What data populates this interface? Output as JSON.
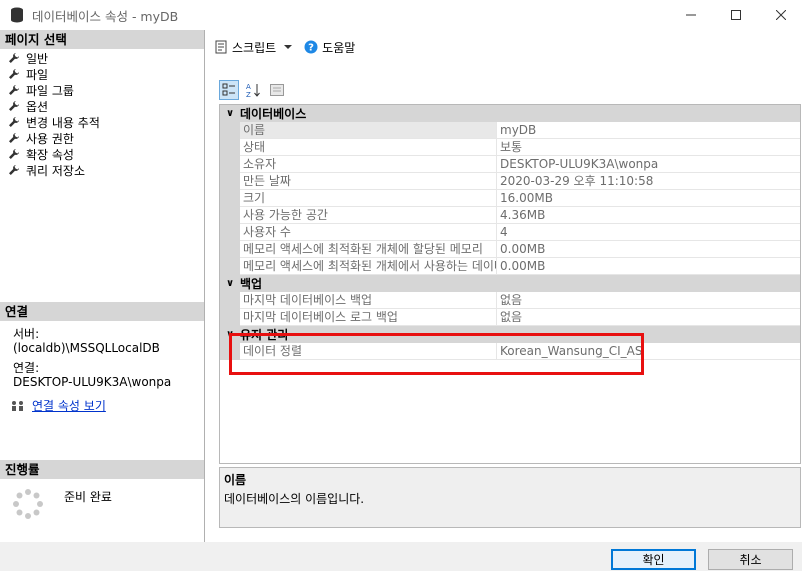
{
  "window": {
    "title": "데이터베이스 속성 - myDB"
  },
  "left": {
    "select_page_header": "페이지 선택",
    "pages": [
      {
        "label": "일반"
      },
      {
        "label": "파일"
      },
      {
        "label": "파일 그룹"
      },
      {
        "label": "옵션"
      },
      {
        "label": "변경 내용 추적"
      },
      {
        "label": "사용 권한"
      },
      {
        "label": "확장 속성"
      },
      {
        "label": "쿼리 저장소"
      }
    ],
    "connection_header": "연결",
    "server_label": "서버:",
    "server_value": "(localdb)\\MSSQLLocalDB",
    "conn_label": "연결:",
    "conn_value": "DESKTOP-ULU9K3A\\wonpa",
    "view_conn_link": "연결 속성 보기",
    "progress_header": "진행률",
    "progress_status": "준비 완료"
  },
  "toolbar": {
    "script_label": "스크립트",
    "help_label": "도움말"
  },
  "grid": {
    "categories": [
      {
        "name": "데이터베이스",
        "rows": [
          {
            "name": "이름",
            "value": "myDB"
          },
          {
            "name": "상태",
            "value": "보통"
          },
          {
            "name": "소유자",
            "value": "DESKTOP-ULU9K3A\\wonpa"
          },
          {
            "name": "만든 날짜",
            "value": "2020-03-29 오후 11:10:58"
          },
          {
            "name": "크기",
            "value": "16.00MB"
          },
          {
            "name": "사용 가능한 공간",
            "value": "4.36MB"
          },
          {
            "name": "사용자 수",
            "value": "4"
          },
          {
            "name": "메모리 액세스에 최적화된 개체에 할당된 메모리",
            "value": "0.00MB"
          },
          {
            "name": "메모리 액세스에 최적화된 개체에서 사용하는 데이터",
            "value": "0.00MB"
          }
        ]
      },
      {
        "name": "백업",
        "rows": [
          {
            "name": "마지막 데이터베이스 백업",
            "value": "없음"
          },
          {
            "name": "마지막 데이터베이스 로그 백업",
            "value": "없음"
          }
        ]
      },
      {
        "name": "유지 관리",
        "rows": [
          {
            "name": "데이터 정렬",
            "value": "Korean_Wansung_CI_AS"
          }
        ]
      }
    ]
  },
  "description": {
    "name": "이름",
    "text": "데이터베이스의 이름입니다."
  },
  "buttons": {
    "ok": "확인",
    "cancel": "취소"
  },
  "colors": {
    "highlight": "#e81010",
    "header_gray": "#d6d6d6",
    "link": "#0033cc"
  }
}
